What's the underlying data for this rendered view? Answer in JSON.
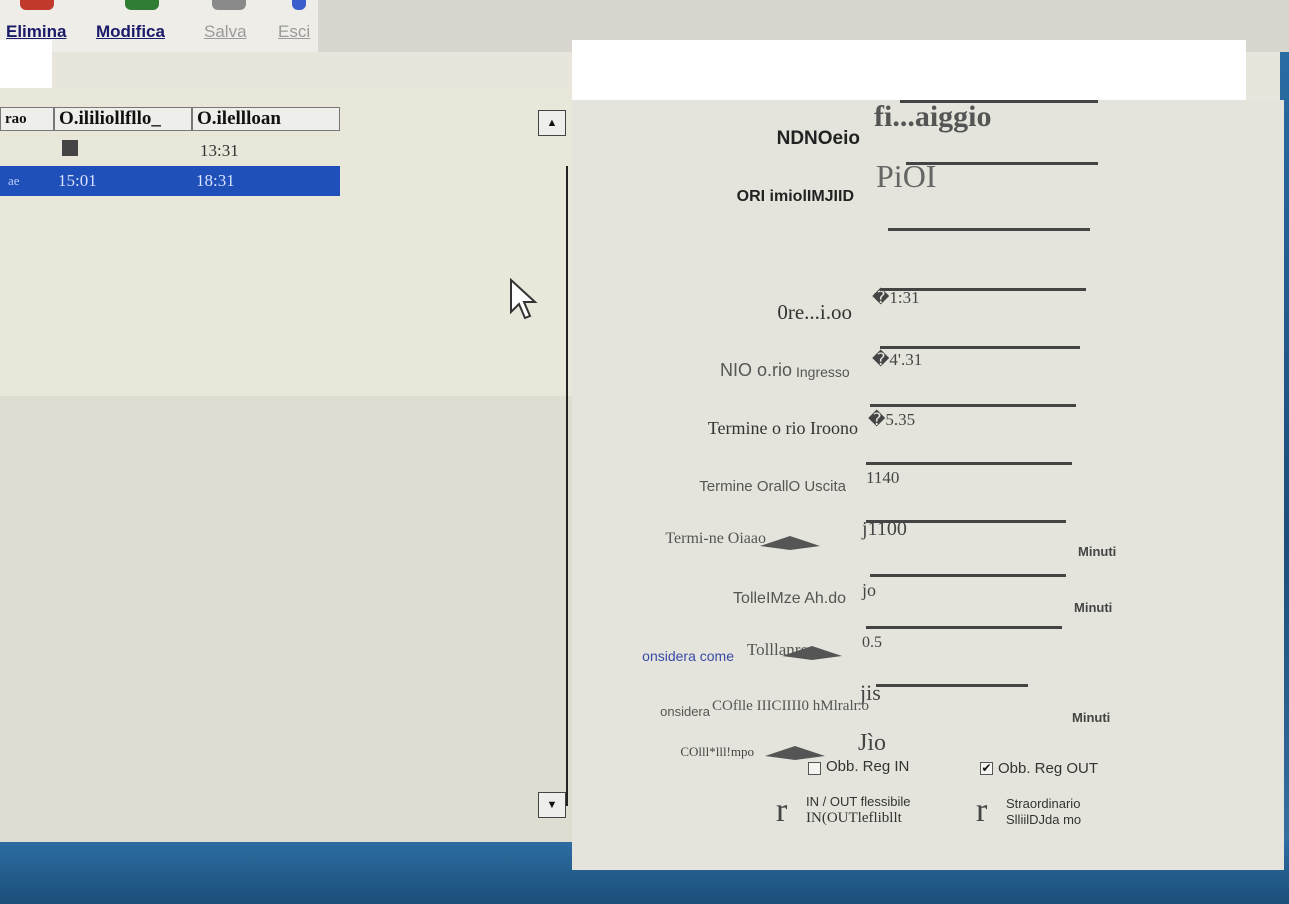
{
  "toolbar": {
    "elimina": "Elimina",
    "modifica": "Modifica",
    "salva": "Salva",
    "esci": "Esci"
  },
  "grid": {
    "columns": [
      "rao",
      "O.ililiollfllo_",
      "O.ilellloan"
    ],
    "rows": [
      {
        "c1": "",
        "c2": "13:31"
      },
      {
        "c0": "ae",
        "c1": "15:01",
        "c2": "18:31"
      }
    ]
  },
  "form": {
    "label_ndnoeio": "NDNOeio",
    "value_ndnoeio": "fi...aiggio",
    "label_ori": "ORI imiolIMJIID",
    "value_ori": "PiOI",
    "label_ore": "0re...i.oo",
    "value_ore": "�1:31",
    "label_nio": "NIO o.rio",
    "label_ingresso": "Ingresso",
    "value_nio": "�4'.31",
    "label_termine1": "Termine o rio Iroono",
    "value_termine1": "�5.35",
    "label_termine2": "Termine OrallO Uscita",
    "value_termine2": "1140",
    "label_termine3": "Termi-ne Oiaao",
    "value_termine3": "j1100",
    "unit_minuti1": "Minuti",
    "label_tollerma": "TolleIMze Ah.do",
    "value_tollerma": "jo",
    "unit_minuti2": "Minuti",
    "label_considera1": "onsidera come",
    "label_tolllanre": "Tolllanre",
    "value_tolllanre": "0.5",
    "label_considera2": "onsidera",
    "label_considera2b": "COflle IIICIIII0 hMlralr.o",
    "value_considera2": "jis",
    "unit_minuti3": "Minuti",
    "label_colllmpo": "COlll*lll!mpo",
    "value_colllmpo": "Jìo"
  },
  "checkboxes": {
    "obb_reg_in": "Obb. Reg IN",
    "obb_reg_out": "Obb. Reg OUT",
    "inout_flessibile": "IN / OUT flessibile",
    "inout_flessibile_b": "IN(OUTleflibllt",
    "straordinario": "Straordinario",
    "straordinario_b": "SlliilDJda mo",
    "big_r": "r"
  }
}
